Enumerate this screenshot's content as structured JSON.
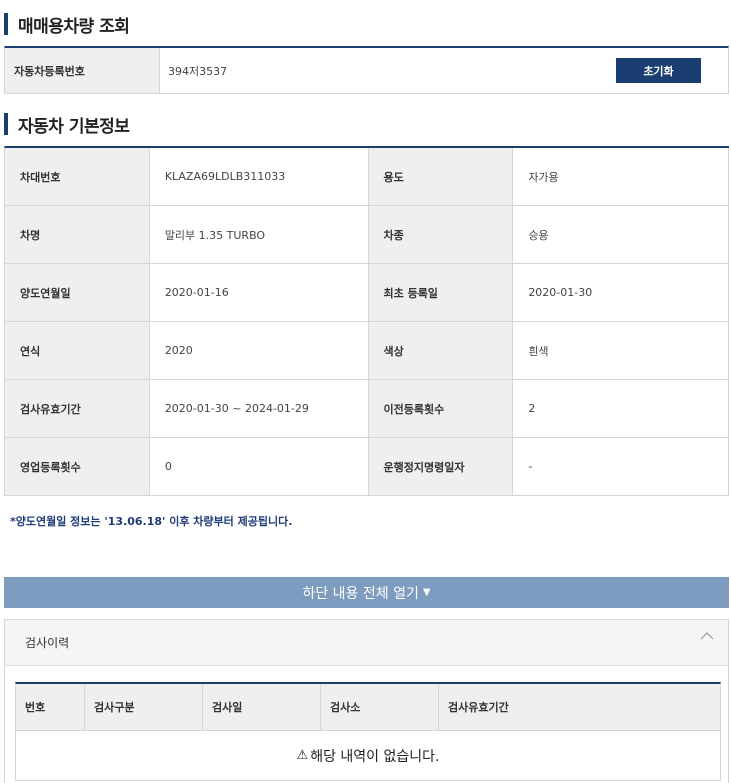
{
  "search_section": {
    "title": "매매용차량 조회",
    "field_label": "자동차등록번호",
    "field_value": "394저3537",
    "reset_label": "초기화"
  },
  "info_section": {
    "title": "자동차 기본정보",
    "rows": [
      {
        "l1": "차대번호",
        "v1": "KLAZA69LDLB311033",
        "l2": "용도",
        "v2": "자가용"
      },
      {
        "l1": "차명",
        "v1": "말리부 1.35 TURBO",
        "l2": "차종",
        "v2": "승용"
      },
      {
        "l1": "양도연월일",
        "v1": "2020-01-16",
        "l2": "최초 등록일",
        "v2": "2020-01-30"
      },
      {
        "l1": "연식",
        "v1": "2020",
        "l2": "색상",
        "v2": "흰색"
      },
      {
        "l1": "검사유효기간",
        "v1": "2020-01-30 ~ 2024-01-29",
        "l2": "이전등록횟수",
        "v2": "2"
      },
      {
        "l1": "영업등록횟수",
        "v1": "0",
        "l2": "운행정지명령일자",
        "v2": "-"
      }
    ],
    "notice": "*양도연월일 정보는 '13.06.18' 이후 차량부터 제공됩니다."
  },
  "expand_bar": {
    "label": "하단 내용 전체 열기",
    "arrow": "▼"
  },
  "inspection": {
    "title": "검사이력",
    "columns": [
      "번호",
      "검사구분",
      "검사일",
      "검사소",
      "검사유효기간"
    ],
    "empty_icon": "warning-icon",
    "empty_message": "해당 내역이 없습니다."
  },
  "colors": {
    "navy": "#1a3e72",
    "expand_bar": "#7d9cc0",
    "header_cell": "#efefef"
  }
}
